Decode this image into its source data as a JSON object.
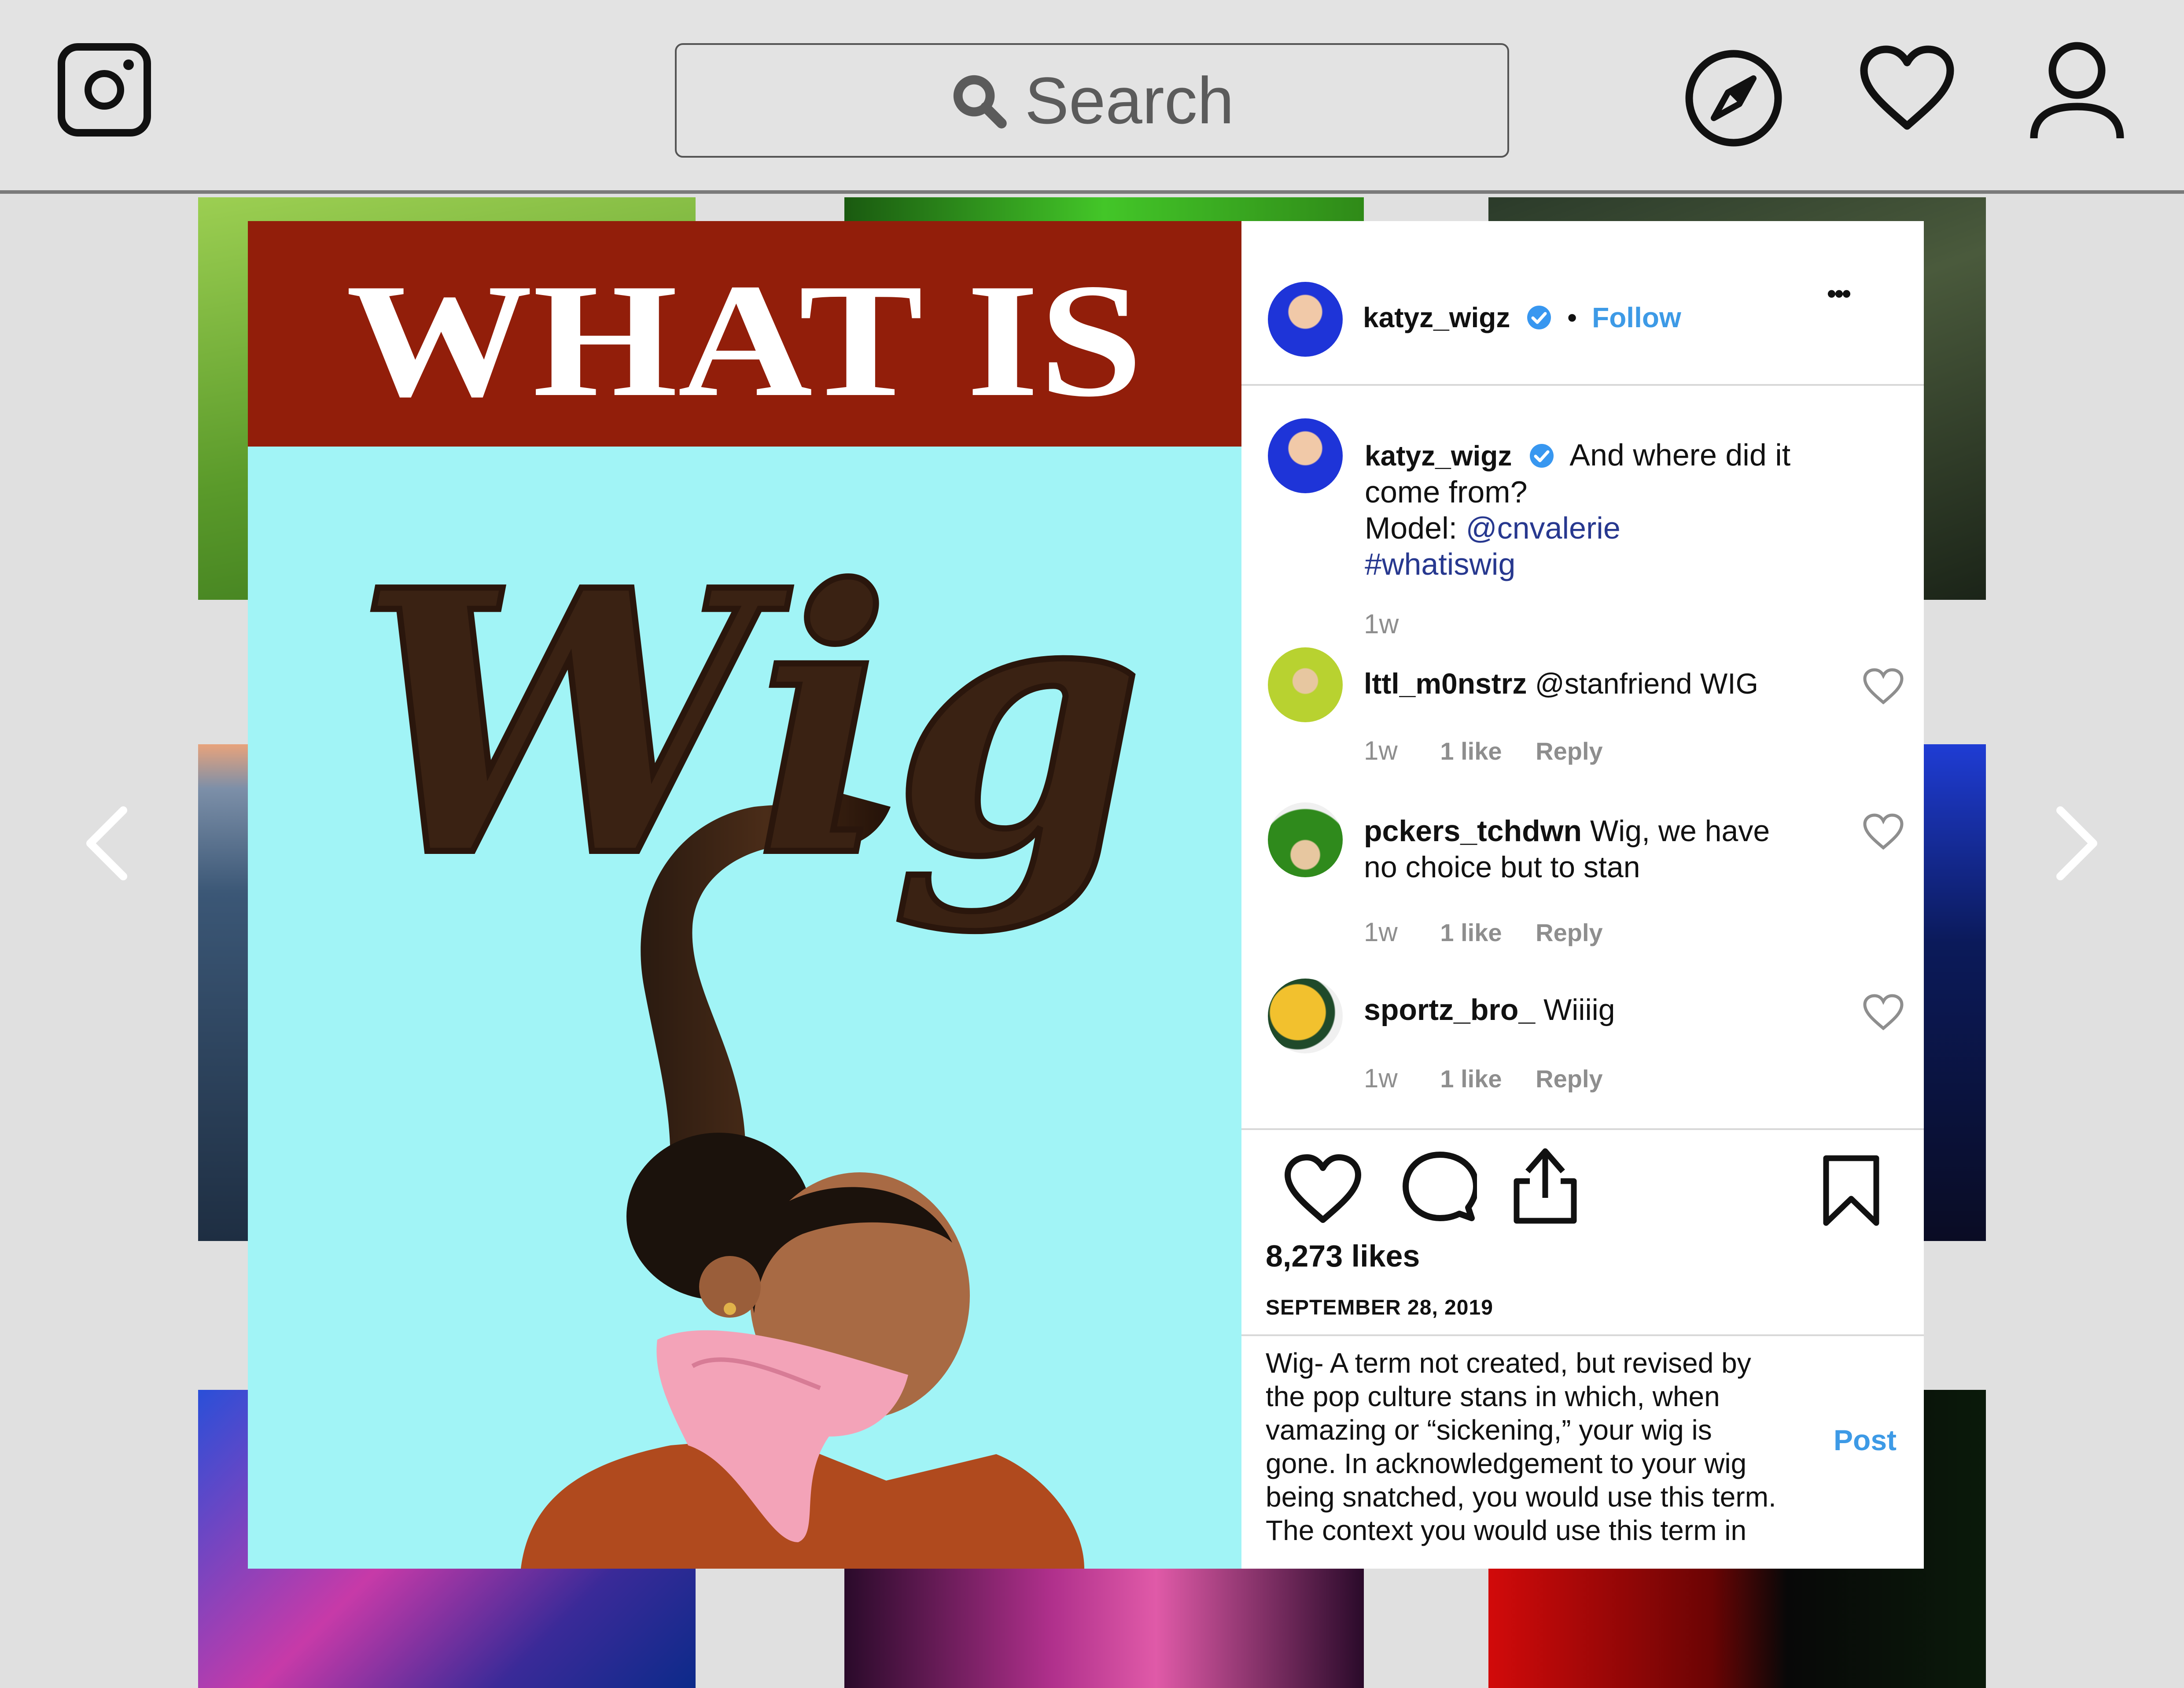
{
  "search": {
    "placeholder": "Search"
  },
  "nav": {
    "icons": [
      "camera-logo-icon",
      "compass-icon",
      "heart-icon",
      "person-icon"
    ]
  },
  "post": {
    "banner_text": "WHAT IS",
    "script_word": "Wig",
    "author": "katyz_wigz",
    "follow_label": "Follow",
    "more_label": "•••",
    "caption": {
      "line1": "And where did it",
      "line2": "come from?",
      "model_label": "Model:",
      "model_handle": "@cnvalerie",
      "hashtag": "#whatiswig",
      "time": "1w"
    },
    "comments": [
      {
        "user": "lttl_m0nstrz",
        "text_line1": "@stanfriend WIG",
        "text_line2": "",
        "time": "1w",
        "likes": "1 like",
        "reply": "Reply"
      },
      {
        "user": "pckers_tchdwn",
        "text_line1": "Wig, we have",
        "text_line2": "no choice but to stan",
        "time": "1w",
        "likes": "1 like",
        "reply": "Reply"
      },
      {
        "user": "sportz_bro_",
        "text_line1": "Wiiiig",
        "text_line2": "",
        "time": "1w",
        "likes": "1 like",
        "reply": "Reply"
      }
    ],
    "likes": "8,273 likes",
    "date": "SEPTEMBER 28, 2019",
    "comment_draft": [
      "Wig- A term not created, but revised by",
      "the pop culture stans in which, when",
      "vamazing or “sickening,” your wig is",
      "gone. In acknowledgement to your wig",
      "being snatched, you would use this term.",
      "The context you would use this term in"
    ],
    "post_button": "Post"
  },
  "colors": {
    "banner": "#921e0a",
    "image_bg": "#a1f4f6",
    "follow": "#3d9ae6",
    "verified": "#3897f0",
    "link": "#27388f"
  }
}
